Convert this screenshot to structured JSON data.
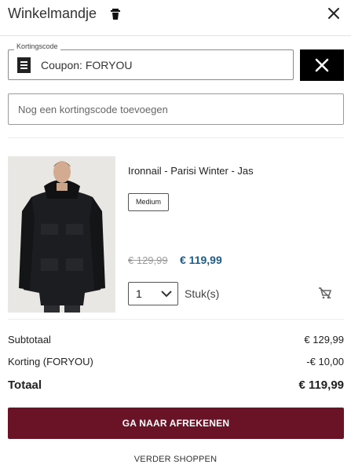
{
  "header": {
    "title": "Winkelmandje",
    "trash_icon": "trash-icon",
    "close_icon": "close-icon"
  },
  "coupon": {
    "legend": "Kortingscode",
    "icon": "receipt-icon",
    "applied_text": "Coupon: FORYOU",
    "remove_icon": "close-icon"
  },
  "code_input": {
    "placeholder": "Nog een kortingscode toevoegen",
    "value": ""
  },
  "cart_item": {
    "name": "Ironnail - Parisi Winter - Jas",
    "size": "Medium",
    "price_old": "€ 129,99",
    "price_new": "€ 119,99",
    "quantity": "1",
    "quantity_unit": "Stuk(s)",
    "remove_icon": "remove-from-cart-icon"
  },
  "summary": {
    "subtotal_label": "Subtotaal",
    "subtotal_value": "€ 129,99",
    "discount_label": "Korting (FORYOU)",
    "discount_value": "-€ 10,00",
    "total_label": "Totaal",
    "total_value": "€ 119,99"
  },
  "actions": {
    "checkout_label": "GA NAAR AFREKENEN",
    "continue_label": "VERDER SHOPPEN"
  },
  "colors": {
    "accent": "#6b1326",
    "price": "#1a5d8c"
  }
}
